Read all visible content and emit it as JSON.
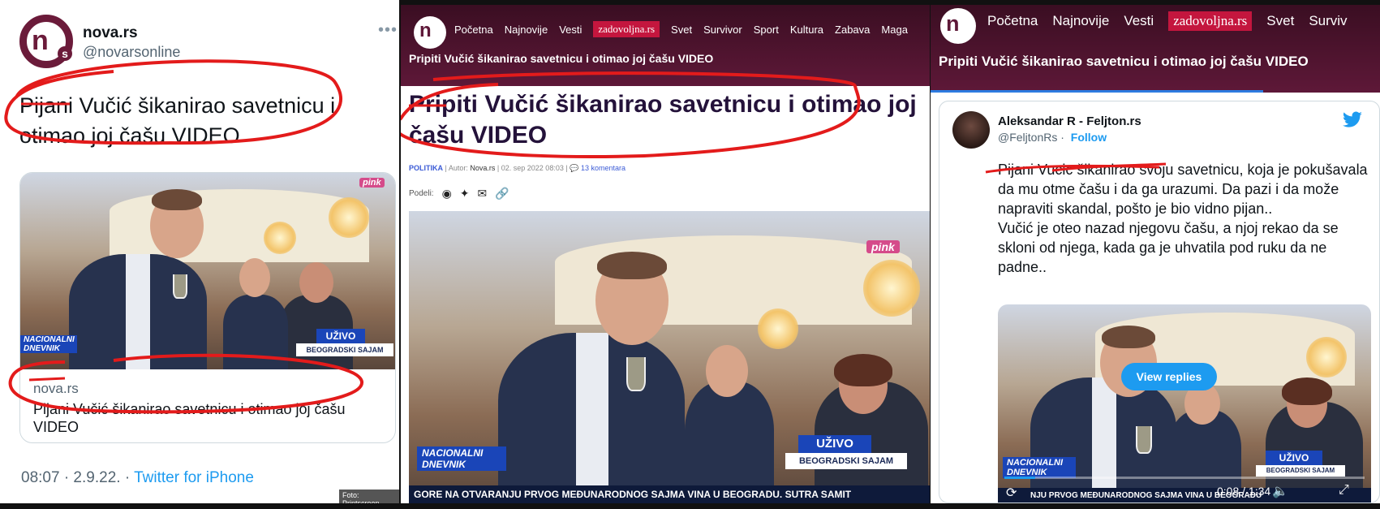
{
  "panel1": {
    "account_name": "nova.rs",
    "account_handle": "@novarsonline",
    "more_icon": "more-dots-icon",
    "tweet_text": "Pijani Vučić šikanirao savetnicu i otimao joj čašu VIDEO",
    "card": {
      "domain": "nova.rs",
      "title": "Pijani Vučić šikanirao savetnicu i otimao joj čašu VIDEO",
      "live_label": "UŽIVO",
      "place_label": "BEOGRADSKI SAJAM",
      "show_label": "NACIONALNI DNEVNIK",
      "channel": "pink"
    },
    "timestamp": "08:07 · 2.9.22. ·",
    "source": "Twitter for iPhone",
    "photo_credit": "Foto: Printscreen"
  },
  "panel2": {
    "nav": {
      "items": [
        "Početna",
        "Najnovije",
        "Vesti"
      ],
      "brand": "zadovoljna.rs",
      "items2": [
        "Svet",
        "Survivor",
        "Sport",
        "Kultura",
        "Zabava",
        "Maga"
      ]
    },
    "header_title": "Pripiti Vučić šikanirao savetnicu i otimao joj čašu VIDEO",
    "title": "Pripiti Vučić šikanirao savetnicu i otimao joj čašu VIDEO",
    "meta": {
      "category": "POLITIKA",
      "author_label": "Autor:",
      "author": "Nova.rs",
      "date": "02. sep 2022 08:03",
      "comments": "13 komentara"
    },
    "share_label": "Podeli:",
    "video": {
      "live_label": "UŽIVO",
      "place_label": "BEOGRADSKI SAJAM",
      "show_label": "NACIONALNI DNEVNIK",
      "ticker": "GORE NA OTVARANJU PRVOG MEĐUNARODNOG SAJMA VINA U BEOGRADU. SUTRA SAMIT",
      "channel": "pink"
    }
  },
  "panel3": {
    "nav": {
      "items": [
        "Početna",
        "Najnovije",
        "Vesti"
      ],
      "brand": "zadovoljna.rs",
      "items2": [
        "Svet",
        "Surviv"
      ]
    },
    "header_title": "Pripiti Vučić šikanirao savetnicu i otimao joj čašu VIDEO",
    "reading_progress": 0.74,
    "tweet": {
      "name": "Aleksandar R - Feljton.rs",
      "handle": "@FeljtonRs",
      "follow_label": "Follow",
      "text": "Pijani Vucic šikanirao svoju savetnicu, koja je pokušavala da mu otme čašu i da ga urazumi. Da pazi i da može napraviti skandal, pošto je bio vidno pijan..\nVučić je oteo nazad njegovu čašu, a njoj rekao da se skloni od njega, kada ga je uhvatila pod ruku da ne padne..",
      "view_replies": "View replies",
      "video_time": "0:08 / 1:34",
      "video_progress": 0.085,
      "live_label": "UŽIVO",
      "place_label": "BEOGRADSKI SAJAM",
      "show_label": "NACIONALNI DNEVNIK",
      "ticker": "NJU PRVOG MEĐUNARODNOG SAJMA VINA U BEOGRADU"
    }
  },
  "colors": {
    "brand_maroon": "#5e1838",
    "brand_red": "#c4163e",
    "twitter_blue": "#1d9bf0",
    "marker_red": "#e31b1b"
  }
}
